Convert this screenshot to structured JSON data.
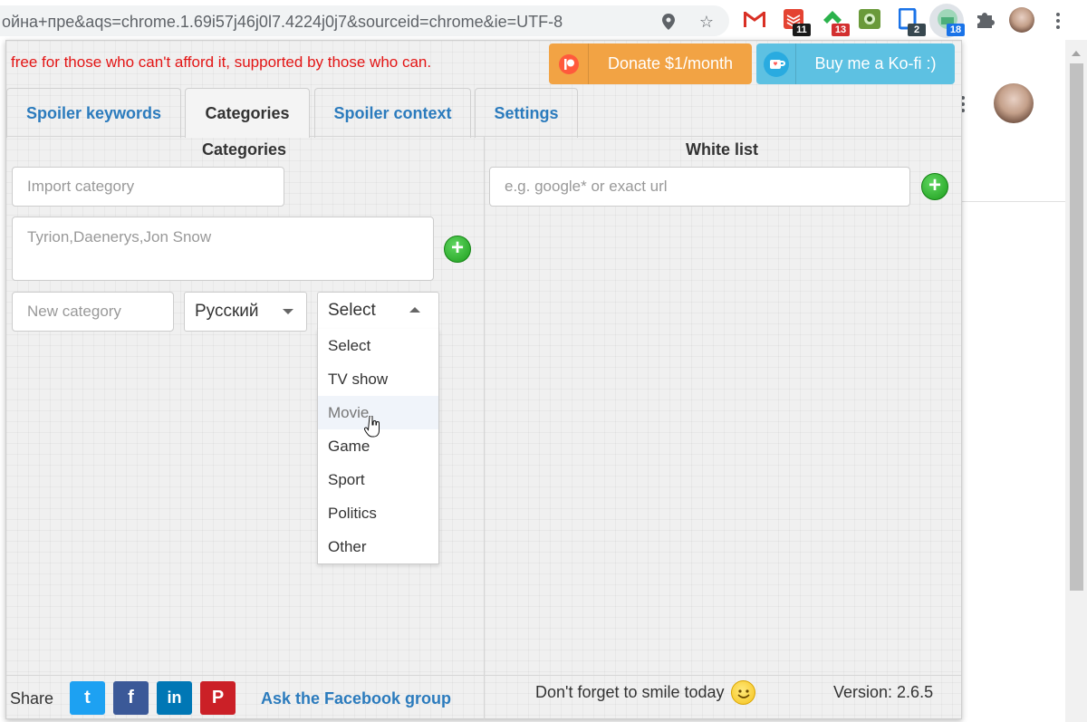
{
  "browser": {
    "url": "ойна+пре&aqs=chrome.1.69i57j46j0l7.4224j0j7&sourceid=chrome&ie=UTF-8",
    "icons": [
      "location-pin-icon",
      "star-icon"
    ],
    "extensions": [
      {
        "name": "gmail-icon",
        "badge": ""
      },
      {
        "name": "todoist-icon",
        "badge": "11"
      },
      {
        "name": "feedly-icon",
        "badge": "13"
      },
      {
        "name": "screen-recorder-icon",
        "badge": ""
      },
      {
        "name": "tab-manager-icon",
        "badge": "2"
      },
      {
        "name": "spoiler-blocker-icon",
        "badge": "18"
      },
      {
        "name": "puzzle-icon",
        "badge": ""
      }
    ],
    "badge_colors": {
      "11": "#1a1a1a",
      "13": "#d32f2f",
      "2": "#37474f",
      "18": "#1a73e8"
    }
  },
  "popup": {
    "slogan": "free for those who can't afford it, supported by those who can.",
    "donate_label": "Donate $1/month",
    "kofi_label": "Buy me a Ko-fi :)",
    "tabs": [
      {
        "label": "Spoiler keywords"
      },
      {
        "label": "Categories"
      },
      {
        "label": "Spoiler context"
      },
      {
        "label": "Settings"
      }
    ],
    "active_tab": "Categories",
    "categories": {
      "title": "Categories",
      "import_placeholder": "Import category",
      "keywords_placeholder": "Tyrion,Daenerys,Jon Snow",
      "new_category_placeholder": "New category",
      "language": "Русский",
      "type_select": "Select",
      "type_options": [
        "Select",
        "TV show",
        "Movie",
        "Game",
        "Sport",
        "Politics",
        "Other"
      ],
      "hovered_option": "Movie"
    },
    "whitelist": {
      "title": "White list",
      "url_placeholder": "e.g. google* or exact url"
    },
    "footer": {
      "share_label": "Share",
      "social": [
        "twitter-icon",
        "facebook-icon",
        "linkedin-icon",
        "pinterest-icon"
      ],
      "social_glyphs": {
        "twitter": "t",
        "facebook": "f",
        "linkedin": "in",
        "pinterest": "P"
      },
      "social_colors": {
        "twitter": "#1da1f2",
        "facebook": "#3b5998",
        "linkedin": "#0077b5",
        "pinterest": "#cb2027"
      },
      "facebook_group_link": "Ask the Facebook group",
      "smile_text": "Don't forget to smile today",
      "version": "Version: 2.6.5"
    }
  }
}
